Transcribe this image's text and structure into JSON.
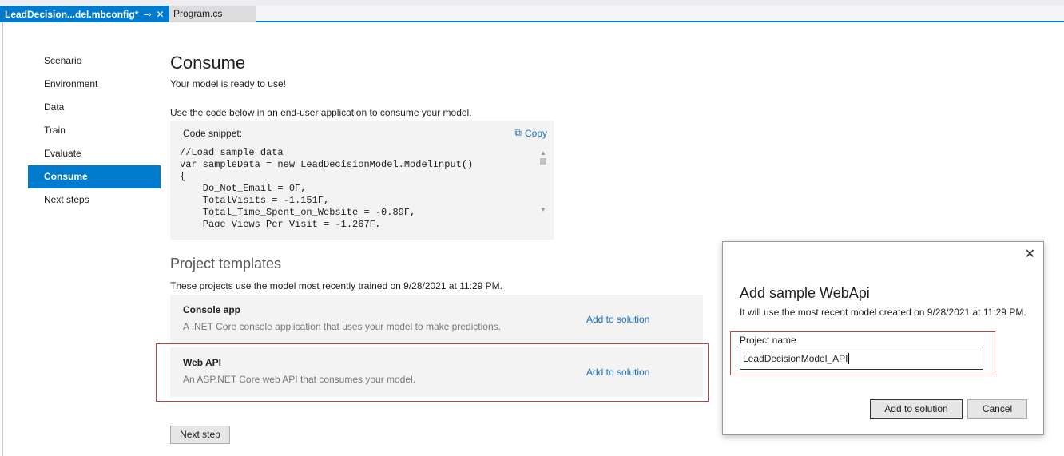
{
  "tabs": [
    {
      "label": "LeadDecision...del.mbconfig*",
      "active": true
    },
    {
      "label": "Program.cs",
      "active": false
    }
  ],
  "nav": [
    "Scenario",
    "Environment",
    "Data",
    "Train",
    "Evaluate",
    "Consume",
    "Next steps"
  ],
  "title": "Consume",
  "subtitle": "Your model is ready to use!",
  "instructions": "Use the code below in an end-user application to consume your model.",
  "code": {
    "label": "Code snippet:",
    "copy": "Copy",
    "text": "//Load sample data\nvar sampleData = new LeadDecisionModel.ModelInput()\n{\n    Do_Not_Email = 0F,\n    TotalVisits = -1.151F,\n    Total_Time_Spent_on_Website = -0.89F,\n    Page_Views_Per_Visit = -1.267F,"
  },
  "templates": {
    "heading": "Project templates",
    "desc": "These projects use the model most recently trained on 9/28/2021 at 11:29 PM.",
    "items": [
      {
        "title": "Console app",
        "desc": "A .NET Core console application that uses your model to make predictions.",
        "action": "Add to solution"
      },
      {
        "title": "Web API",
        "desc": "An ASP.NET Core web API that consumes your model.",
        "action": "Add to solution"
      }
    ]
  },
  "next_step": "Next step",
  "dialog": {
    "title": "Add sample WebApi",
    "desc": "It will use the most recent model created on 9/28/2021 at 11:29 PM.",
    "field_label": "Project name",
    "field_value": "LeadDecisionModel_API",
    "ok": "Add to solution",
    "cancel": "Cancel"
  },
  "colors": {
    "accent": "#007acc",
    "highlight": "#c0424a"
  }
}
